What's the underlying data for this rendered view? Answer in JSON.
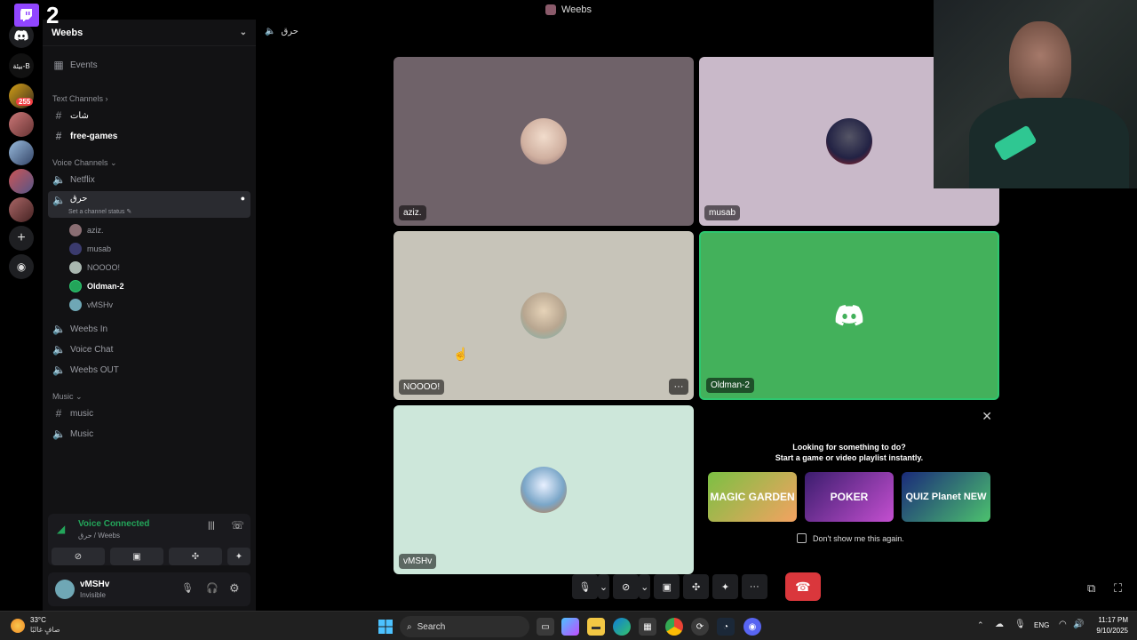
{
  "window": {
    "title": "Weebs"
  },
  "stream_overlay": {
    "viewer_count": "2"
  },
  "rail": {
    "folder_label": "بيئة-B",
    "unread_badge": "255"
  },
  "sidebar": {
    "guild_name": "Weebs",
    "events_label": "Events",
    "text_category": "Text Channels",
    "text_channels": [
      "شات",
      "free-games"
    ],
    "voice_category": "Voice Channels",
    "voice_channels_top": [
      "Netflix"
    ],
    "active_voice_channel": "حرق",
    "channel_status_placeholder": "Set a channel status",
    "members": [
      "aziz.",
      "musab",
      "NOOOO!",
      "Oldman-2",
      "vMSHv"
    ],
    "voice_channels_bottom": [
      "Weebs In",
      "Voice Chat",
      "Weebs OUT"
    ],
    "music_category": "Music",
    "music_channels": [
      "music",
      "Music"
    ]
  },
  "voice_panel": {
    "status": "Voice Connected",
    "location": "حرق / Weebs"
  },
  "user_panel": {
    "username": "vMSHv",
    "status": "Invisible"
  },
  "main": {
    "channel_title": "حرق",
    "tiles": [
      {
        "name": "aziz.",
        "bg": "#6f6269"
      },
      {
        "name": "musab",
        "bg": "#c9b9c9"
      },
      {
        "name": "NOOOO!",
        "bg": "#c7c4b9"
      },
      {
        "name": "Oldman-2",
        "bg": "#43b15b"
      },
      {
        "name": "vMSHv",
        "bg": "#cde7da"
      }
    ],
    "activity": {
      "line1": "Looking for something to do?",
      "line2": "Start a game or video playlist instantly.",
      "games": [
        "MAGIC GARDEN",
        "POKER",
        "QUIZ Planet NEW"
      ],
      "dont_show": "Don't show me this again."
    }
  },
  "taskbar": {
    "weather_temp": "33°C",
    "weather_desc": "صافٍ غالبًا",
    "search_label": "Search",
    "language": "ENG",
    "time": "11:17 PM",
    "date": "9/10/2025"
  },
  "colors": {
    "accent_green": "#23a55a",
    "danger": "#da373c",
    "blurple": "#5865f2"
  }
}
